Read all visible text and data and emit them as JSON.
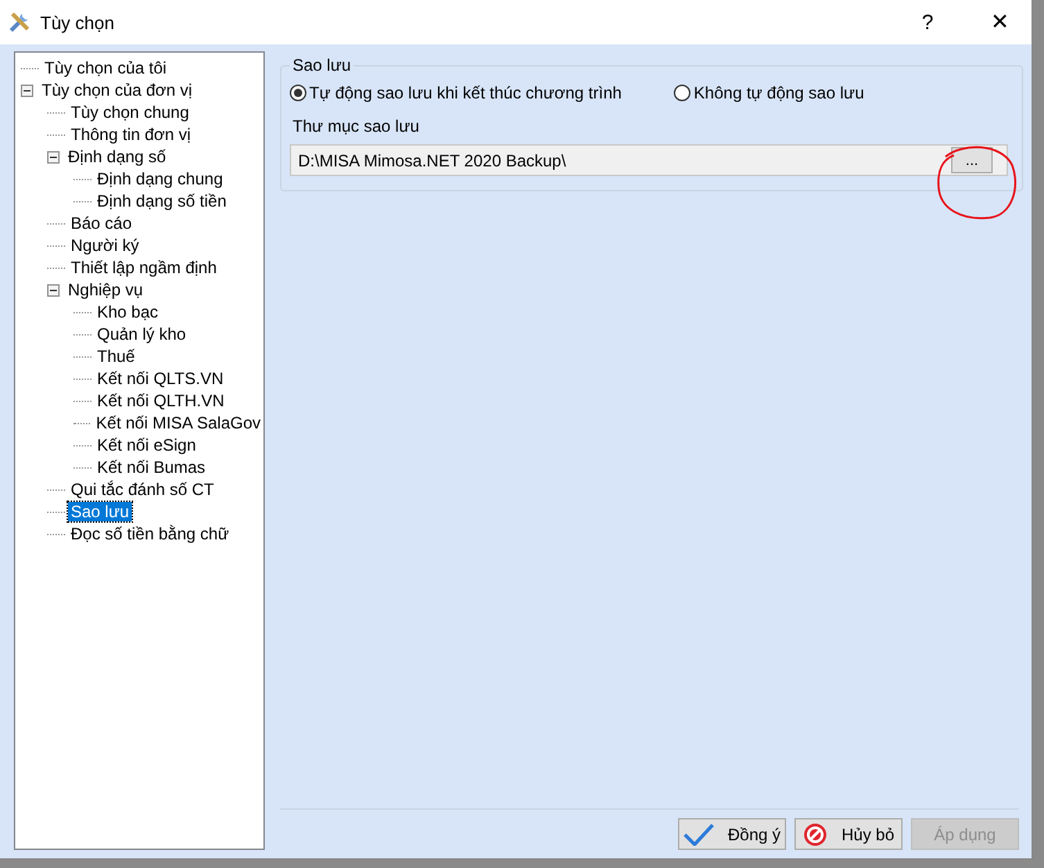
{
  "window": {
    "title": "Tùy chọn",
    "help": "?",
    "close": "✕"
  },
  "tree": [
    {
      "label": "Tùy chọn của tôi",
      "selected": false
    },
    {
      "label": "Tùy chọn của đơn vị",
      "selected": false,
      "expanded": true,
      "children": [
        {
          "label": "Tùy chọn chung",
          "selected": false
        },
        {
          "label": "Thông tin đơn vị",
          "selected": false
        },
        {
          "label": "Định dạng số",
          "selected": false,
          "expanded": true,
          "children": [
            {
              "label": "Định dạng chung",
              "selected": false
            },
            {
              "label": "Định dạng số tiền",
              "selected": false
            }
          ]
        },
        {
          "label": "Báo cáo",
          "selected": false
        },
        {
          "label": "Người ký",
          "selected": false
        },
        {
          "label": "Thiết lập ngầm định",
          "selected": false
        },
        {
          "label": "Nghiệp vụ",
          "selected": false,
          "expanded": true,
          "children": [
            {
              "label": "Kho bạc",
              "selected": false
            },
            {
              "label": "Quản lý kho",
              "selected": false
            },
            {
              "label": "Thuế",
              "selected": false
            },
            {
              "label": "Kết nối QLTS.VN",
              "selected": false
            },
            {
              "label": "Kết nối QLTH.VN",
              "selected": false
            },
            {
              "label": "Kết nối MISA SalaGov",
              "selected": false
            },
            {
              "label": "Kết nối eSign",
              "selected": false
            },
            {
              "label": "Kết nối Bumas",
              "selected": false
            }
          ]
        },
        {
          "label": "Qui tắc đánh số CT",
          "selected": false
        },
        {
          "label": "Sao lưu",
          "selected": true
        },
        {
          "label": "Đọc số tiền bằng chữ",
          "selected": false
        }
      ]
    }
  ],
  "backup": {
    "title": "Sao lưu",
    "options": [
      {
        "label": "Tự động sao lưu khi kết thúc chương trình",
        "selected": true
      },
      {
        "label": "Không tự động sao lưu",
        "selected": false
      }
    ],
    "folder_label": "Thư mục sao lưu",
    "folder_value": "D:\\MISA Mimosa.NET 2020 Backup\\",
    "browse": "..."
  },
  "buttons": [
    {
      "label": "Đồng ý",
      "kind": "ok",
      "disabled": false
    },
    {
      "label": "Hủy bỏ",
      "kind": "cancel",
      "disabled": false
    },
    {
      "label": "Áp dụng",
      "kind": "apply",
      "disabled": true
    }
  ]
}
